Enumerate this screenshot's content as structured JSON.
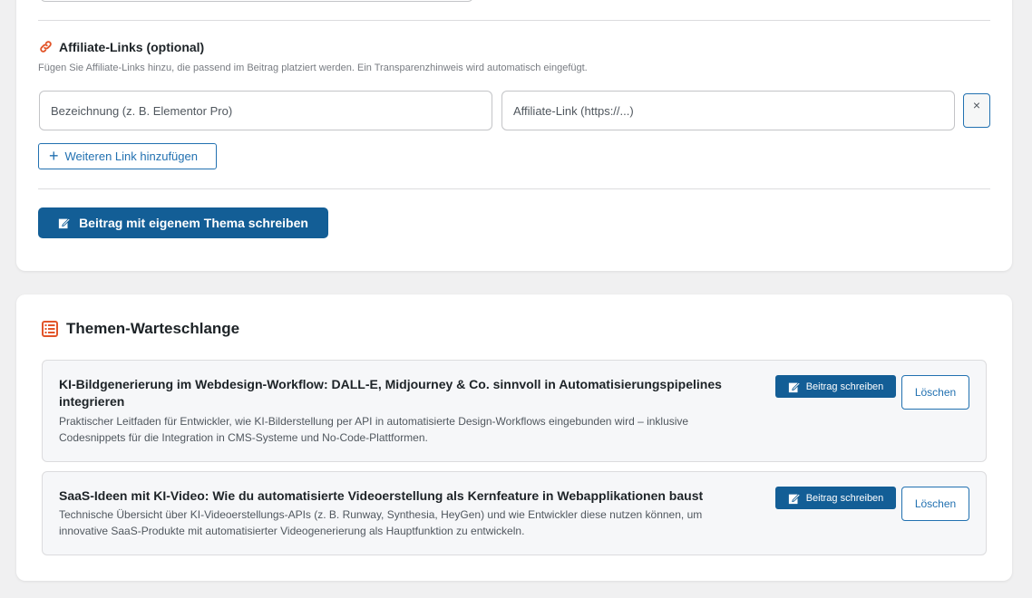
{
  "affiliate": {
    "heading": "Affiliate-Links (optional)",
    "hint": "Fügen Sie Affiliate-Links hinzu, die passend im Beitrag platziert werden. Ein Transparenzhinweis wird automatisch eingefügt.",
    "label_placeholder": "Bezeichnung (z. B. Elementor Pro)",
    "url_placeholder": "Affiliate-Link (https://...)",
    "remove_label": "×",
    "add_link_label": "Weiteren Link hinzufügen",
    "add_icon": "+"
  },
  "write_own_topic_label": "Beitrag mit eigenem Thema schreiben",
  "queue": {
    "heading": "Themen-Warteschlange",
    "items": [
      {
        "title": "KI-Bildgenerierung im Webdesign-Workflow: DALL-E, Midjourney & Co. sinnvoll in Automatisierungspipelines integrieren",
        "description": "Praktischer Leitfaden für Entwickler, wie KI-Bilderstellung per API in automatisierte Design-Workflows eingebunden wird – inklusive Codesnippets für die Integration in CMS-Systeme und No-Code-Plattformen.",
        "write_label": "Beitrag schreiben",
        "delete_label": "Löschen"
      },
      {
        "title": "SaaS-Ideen mit KI-Video: Wie du automatisierte Videoerstellung als Kernfeature in Webapplikationen baust",
        "description": "Technische Übersicht über KI-Videoerstellungs-APIs (z. B. Runway, Synthesia, HeyGen) und wie Entwickler diese nutzen können, um innovative SaaS-Produkte mit automatisierter Videogenerierung als Hauptfunktion zu entwickeln.",
        "write_label": "Beitrag schreiben",
        "delete_label": "Löschen"
      }
    ]
  },
  "icons": {
    "link": "link-icon",
    "edit": "edit-icon",
    "list": "list-icon",
    "close": "close-icon",
    "plus": "plus-icon"
  },
  "colors": {
    "primary": "#135e96",
    "accent_link": "#2271b1",
    "icon_orange": "#e2552a",
    "page_bg": "#f0f0f1"
  }
}
